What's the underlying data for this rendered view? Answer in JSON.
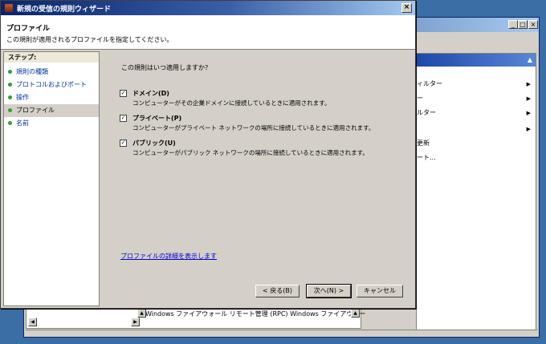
{
  "wizard": {
    "title": "新規の受信の規則ウィザード",
    "close_glyph": "×",
    "heading": "プロファイル",
    "subheading": "この規則が適用されるプロファイルを指定してください。",
    "steps_title": "ステップ:",
    "steps": [
      {
        "label": "規則の種類",
        "active": false
      },
      {
        "label": "プロトコルおよびポート",
        "active": false
      },
      {
        "label": "操作",
        "active": false
      },
      {
        "label": "プロファイル",
        "active": true
      },
      {
        "label": "名前",
        "active": false
      }
    ],
    "question": "この規則はいつ適用しますか?",
    "options": [
      {
        "title": "ドメイン(D)",
        "desc": "コンピューターがその企業ドメインに接続しているときに適用されます。",
        "checked": true
      },
      {
        "title": "プライベート(P)",
        "desc": "コンピューターがプライベート ネットワークの場所に接続しているときに適用されます。",
        "checked": true
      },
      {
        "title": "パブリック(U)",
        "desc": "コンピューターがパブリック ネットワークの場所に接続しているときに適用されます。",
        "checked": true
      }
    ],
    "check_glyph": "✓",
    "details_link": "プロファイルの詳細を表示します",
    "buttons": {
      "back": "< 戻る(B)",
      "next": "次へ(N) >",
      "cancel": "キャンセル"
    }
  },
  "background_window": {
    "controls": [
      "_",
      "□",
      "×"
    ],
    "actions_up_glyph": "▲",
    "actions": [
      {
        "label": "ィルター",
        "arrow": "▶"
      },
      {
        "label": "ー",
        "arrow": "▶"
      },
      {
        "label": "ルター",
        "arrow": "▶"
      },
      {
        "label": "",
        "arrow": "▶"
      },
      {
        "label": "更新",
        "arrow": ""
      },
      {
        "label": "ート...",
        "arrow": ""
      }
    ],
    "bottom_text": "Windows ファイアウォール リモート管理 (RPC)   Windows ファイアウォー"
  },
  "colors": {
    "titlebar": "#0a246a",
    "face": "#d4d0c8",
    "desktop": "#3a6ea5",
    "link": "#0000cc"
  }
}
